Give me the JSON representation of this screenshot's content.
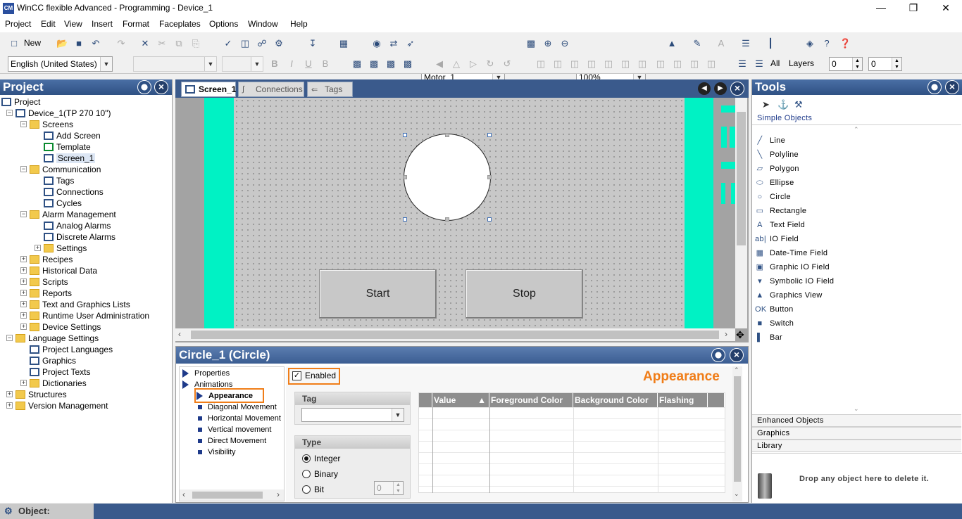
{
  "window": {
    "title": "WinCC flexible Advanced - Programming - Device_1",
    "app_icon": "CM"
  },
  "menu": [
    "Project",
    "Edit",
    "View",
    "Insert",
    "Format",
    "Faceplates",
    "Options",
    "Window",
    "Help"
  ],
  "toolbar": {
    "new_label": "New",
    "tag_combo": "Motor_1",
    "zoom_combo": "100%",
    "language_combo": "English (United States)",
    "all_label": "All",
    "layers_label": "Layers",
    "layer_from": "0",
    "layer_to": "0"
  },
  "project_panel": {
    "title": "Project",
    "tree": [
      {
        "label": "Project",
        "icon": "project-icon"
      },
      {
        "label": "Device_1(TP 270 10\")",
        "icon": "device-icon"
      },
      {
        "label": "Screens",
        "icon": "folder-icon"
      },
      {
        "label": "Add Screen",
        "icon": "add-screen-icon"
      },
      {
        "label": "Template",
        "icon": "template-icon"
      },
      {
        "label": "Screen_1",
        "icon": "screen-icon"
      },
      {
        "label": "Communication",
        "icon": "folder-icon"
      },
      {
        "label": "Tags",
        "icon": "tags-icon"
      },
      {
        "label": "Connections",
        "icon": "connections-icon"
      },
      {
        "label": "Cycles",
        "icon": "cycles-icon"
      },
      {
        "label": "Alarm Management",
        "icon": "folder-icon"
      },
      {
        "label": "Analog Alarms",
        "icon": "analog-alarms-icon"
      },
      {
        "label": "Discrete Alarms",
        "icon": "discrete-alarms-icon"
      },
      {
        "label": "Settings",
        "icon": "folder-icon"
      },
      {
        "label": "Recipes",
        "icon": "folder-icon"
      },
      {
        "label": "Historical Data",
        "icon": "folder-icon"
      },
      {
        "label": "Scripts",
        "icon": "folder-icon"
      },
      {
        "label": "Reports",
        "icon": "folder-icon"
      },
      {
        "label": "Text and Graphics Lists",
        "icon": "folder-icon"
      },
      {
        "label": "Runtime User Administration",
        "icon": "folder-icon"
      },
      {
        "label": "Device Settings",
        "icon": "folder-icon"
      },
      {
        "label": "Language Settings",
        "icon": "folder-icon"
      },
      {
        "label": "Project Languages",
        "icon": "globe-icon"
      },
      {
        "label": "Graphics",
        "icon": "graphics-icon"
      },
      {
        "label": "Project Texts",
        "icon": "texts-icon"
      },
      {
        "label": "Dictionaries",
        "icon": "folder-icon"
      },
      {
        "label": "Structures",
        "icon": "folder-icon"
      },
      {
        "label": "Version Management",
        "icon": "folder-icon"
      }
    ]
  },
  "editor": {
    "tabs": [
      "Screen_1",
      "Connections",
      "Tags"
    ],
    "buttons": {
      "start": "Start",
      "stop": "Stop"
    }
  },
  "properties": {
    "title": "Circle_1 (Circle)",
    "nav": {
      "properties": "Properties",
      "animations": "Animations",
      "items": [
        "Appearance",
        "Diagonal Movement",
        "Horizontal Movement",
        "Vertical movement",
        "Direct Movement",
        "Visibility"
      ]
    },
    "enabled_label": "Enabled",
    "section_title": "Appearance",
    "tag_group_title": "Tag",
    "type_group_title": "Type",
    "type_options": [
      "Integer",
      "Binary",
      "Bit"
    ],
    "bit_value": "0",
    "grid_columns": [
      "Value",
      "Foreground Color",
      "Background Color",
      "Flashing"
    ]
  },
  "tools_panel": {
    "title": "Tools",
    "category_simple": "Simple Objects",
    "items": [
      "Line",
      "Polyline",
      "Polygon",
      "Ellipse",
      "Circle",
      "Rectangle",
      "Text Field",
      "IO Field",
      "Date-Time Field",
      "Graphic IO Field",
      "Symbolic IO Field",
      "Graphics View",
      "Button",
      "Switch",
      "Bar"
    ],
    "categories": [
      "Enhanced Objects",
      "Graphics",
      "Library"
    ],
    "drop_hint": "Drop any object here to delete it."
  },
  "statusbar": {
    "object_label": "Object:"
  },
  "colors": {
    "accent_orange": "#f07d18",
    "panel_blue": "#3a5a8c",
    "screen_aqua": "#00f2c4"
  }
}
